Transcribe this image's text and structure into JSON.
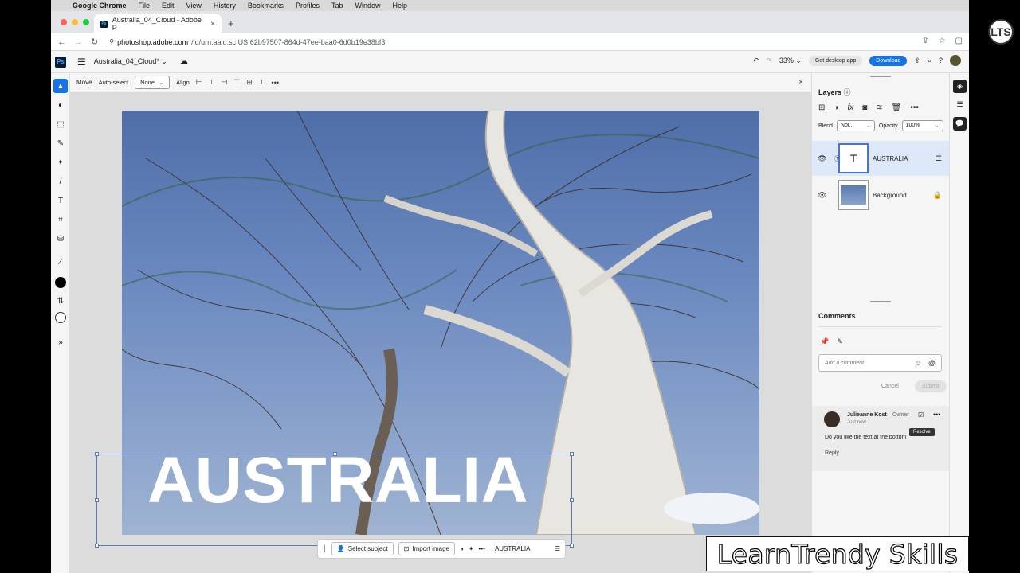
{
  "os_menubar": {
    "app": "Google Chrome",
    "items": [
      "File",
      "Edit",
      "View",
      "History",
      "Bookmarks",
      "Profiles",
      "Tab",
      "Window",
      "Help"
    ]
  },
  "browser": {
    "tab_title": "Australia_04_Cloud - Adobe P",
    "url_host": "photoshop.adobe.com",
    "url_path": "/id/urn:aaid:sc:US:62b97507-864d-47ee-baa0-6d0b19e38bf3",
    "profile_initials": "LTS"
  },
  "ps_header": {
    "logo": "Ps",
    "document_name": "Australia_04_Cloud*",
    "zoom": "33%",
    "get_desktop_app": "Get desktop app",
    "download": "Download"
  },
  "options_bar": {
    "tool": "Move",
    "auto_select_label": "Auto-select",
    "auto_select_value": "None",
    "align_label": "Align"
  },
  "canvas": {
    "text_layer_content": "AUSTRALIA"
  },
  "context_bar": {
    "select_subject": "Select subject",
    "import_image": "Import image",
    "layer_label": "AUSTRALIA"
  },
  "layers_panel": {
    "title": "Layers",
    "blend_label": "Blend",
    "blend_value": "Nor...",
    "opacity_label": "Opacity",
    "opacity_value": "100%",
    "layers": [
      {
        "name": "AUSTRALIA",
        "selected": true
      },
      {
        "name": "Background",
        "selected": false
      }
    ]
  },
  "comments_panel": {
    "title": "Comments",
    "input_placeholder": "Add a comment",
    "cancel": "Cancel",
    "submit": "Submit",
    "comment": {
      "author": "Julieanne Kost",
      "role": "Owner",
      "time": "Just now",
      "text": "Do you like the text at the bottom",
      "reply": "Reply",
      "tooltip": "Resolve"
    }
  },
  "watermark": "LearnTrendy Skills",
  "colors": {
    "accent": "#1473e6",
    "ps_dark": "#001e36",
    "ps_blue": "#31a8ff",
    "selected_layer_bg": "#dde8f8"
  }
}
